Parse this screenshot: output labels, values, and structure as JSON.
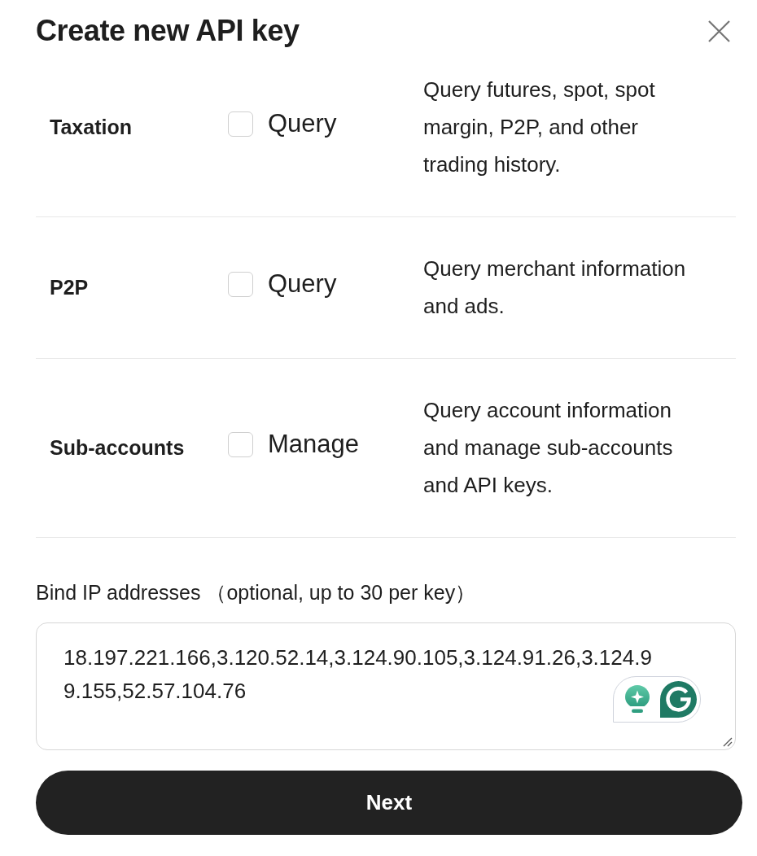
{
  "dialog": {
    "title": "Create new API key"
  },
  "permissions": [
    {
      "category": "Taxation",
      "option": "Query",
      "checked": false,
      "description": "Query futures, spot, spot margin, P2P, and other trading history."
    },
    {
      "category": "P2P",
      "option": "Query",
      "checked": false,
      "description": "Query merchant information and ads."
    },
    {
      "category": "Sub-accounts",
      "option": "Manage",
      "checked": false,
      "description": "Query account information and manage sub-accounts and API keys."
    }
  ],
  "ip_binding": {
    "label": "Bind IP addresses （optional, up to 30 per key）",
    "value": "18.197.221.166,3.120.52.14,3.124.90.105,3.124.91.26,3.124.99.155,52.57.104.76"
  },
  "primary_button": {
    "label": "Next"
  }
}
